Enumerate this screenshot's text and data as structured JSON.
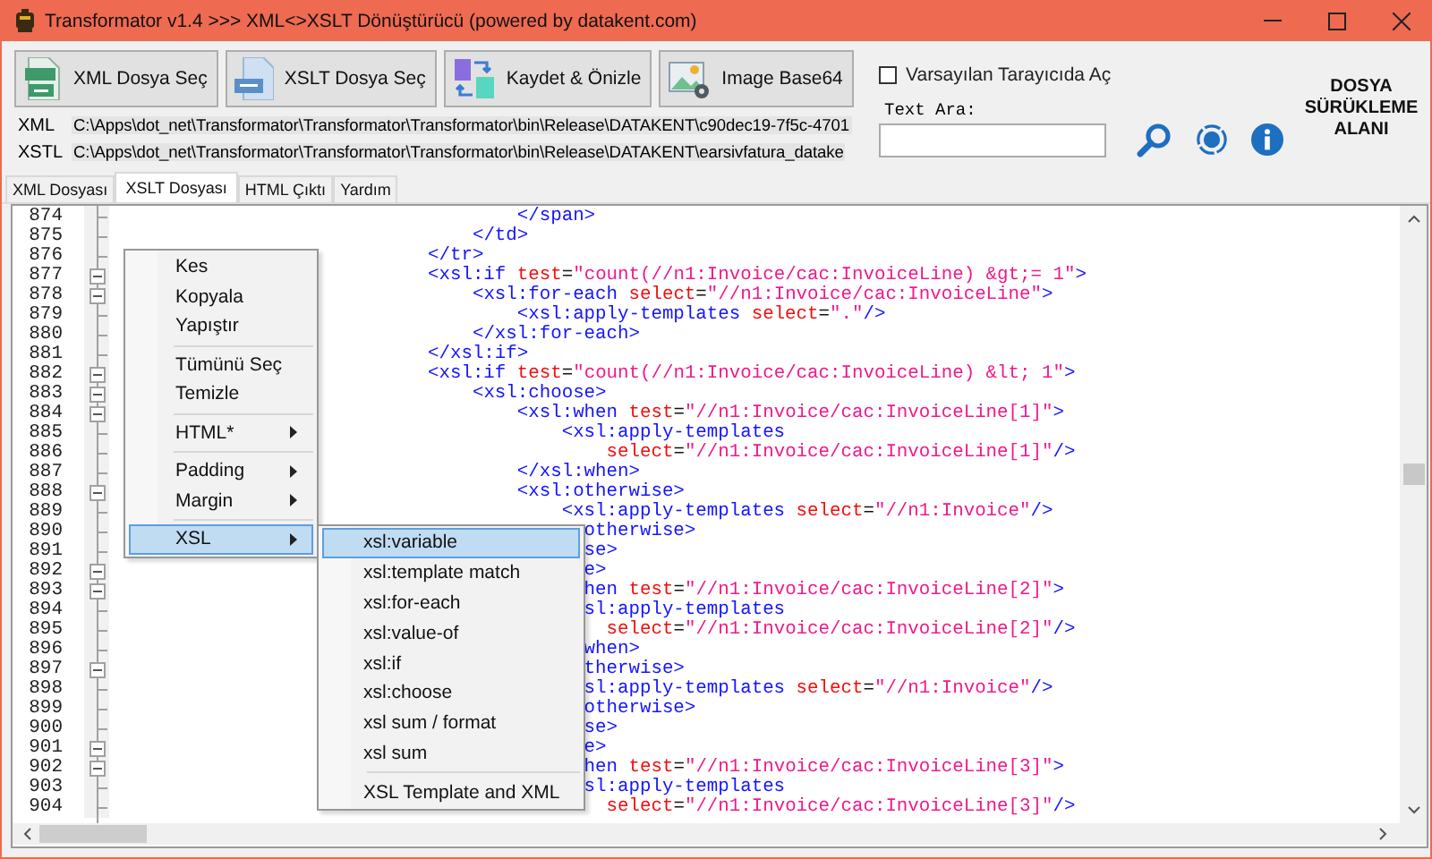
{
  "window": {
    "title": "Transformator v1.4 >>> XML<>XSLT Dönüştürücü (powered by datakent.com)"
  },
  "toolbar": {
    "buttons": [
      {
        "label": "XML Dosya Seç",
        "kind": "xml"
      },
      {
        "label": "XSLT Dosya Seç",
        "kind": "xslt"
      },
      {
        "label": "Kaydet & Önizle",
        "kind": "save"
      },
      {
        "label": "Image Base64",
        "kind": "image"
      }
    ],
    "paths": [
      {
        "label": "XML",
        "value": "C:\\Apps\\dot_net\\Transformator\\Transformator\\Transformator\\bin\\Release\\DATAKENT\\c90dec19-7f5c-4701"
      },
      {
        "label": "XSTL",
        "value": "C:\\Apps\\dot_net\\Transformator\\Transformator\\Transformator\\bin\\Release\\DATAKENT\\earsivfatura_datake"
      }
    ],
    "browser_checkbox": {
      "label": "Varsayılan Tarayıcıda Aç",
      "checked": false
    },
    "search": {
      "label": "Text Ara:"
    },
    "drop_area": {
      "lines": [
        "DOSYA",
        "SÜRÜKLEME",
        "ALANI"
      ]
    }
  },
  "tabs": [
    {
      "label": "XML Dosyası",
      "selected": false
    },
    {
      "label": "XSLT Dosyası",
      "selected": true
    },
    {
      "label": "HTML Çıktı",
      "selected": false
    },
    {
      "label": "Yardım",
      "selected": false
    }
  ],
  "editor": {
    "lines": [
      {
        "number": "874",
        "text": "        </span>",
        "fold": false
      },
      {
        "number": "875",
        "text": "    </td>",
        "fold": false
      },
      {
        "number": "876",
        "text": "</tr>",
        "fold": false
      },
      {
        "number": "877",
        "text": "<xsl:if test=\"count(//n1:Invoice/cac:InvoiceLine) &gt;= 1\">",
        "fold": true
      },
      {
        "number": "878",
        "text": "    <xsl:for-each select=\"//n1:Invoice/cac:InvoiceLine\">",
        "fold": true
      },
      {
        "number": "879",
        "text": "        <xsl:apply-templates select=\".\"/>",
        "fold": false
      },
      {
        "number": "880",
        "text": "    </xsl:for-each>",
        "fold": false
      },
      {
        "number": "881",
        "text": "</xsl:if>",
        "fold": false
      },
      {
        "number": "882",
        "text": "<xsl:if test=\"count(//n1:Invoice/cac:InvoiceLine) &lt; 1\">",
        "fold": true
      },
      {
        "number": "883",
        "text": "    <xsl:choose>",
        "fold": true
      },
      {
        "number": "884",
        "text": "        <xsl:when test=\"//n1:Invoice/cac:InvoiceLine[1]\">",
        "fold": true
      },
      {
        "number": "885",
        "text": "            <xsl:apply-templates",
        "fold": false
      },
      {
        "number": "886",
        "text": "                select=\"//n1:Invoice/cac:InvoiceLine[1]\"/>",
        "fold": false
      },
      {
        "number": "887",
        "text": "        </xsl:when>",
        "fold": false
      },
      {
        "number": "888",
        "text": "        <xsl:otherwise>",
        "fold": true
      },
      {
        "number": "889",
        "text": "            <xsl:apply-templates select=\"//n1:Invoice\"/>",
        "fold": false
      },
      {
        "number": "890",
        "text": "              otherwise>",
        "fold": false
      },
      {
        "number": "891",
        "text": "              se>",
        "fold": false
      },
      {
        "number": "892",
        "text": "              e>",
        "fold": true
      },
      {
        "number": "893",
        "text": "              hen test=\"//n1:Invoice/cac:InvoiceLine[2]\">",
        "fold": true
      },
      {
        "number": "894",
        "text": "              sl:apply-templates",
        "fold": false
      },
      {
        "number": "895",
        "text": "                select=\"//n1:Invoice/cac:InvoiceLine[2]\"/>",
        "fold": false
      },
      {
        "number": "896",
        "text": "              when>",
        "fold": false
      },
      {
        "number": "897",
        "text": "              therwise>",
        "fold": true
      },
      {
        "number": "898",
        "text": "              sl:apply-templates select=\"//n1:Invoice\"/>",
        "fold": false
      },
      {
        "number": "899",
        "text": "              otherwise>",
        "fold": false
      },
      {
        "number": "900",
        "text": "              se>",
        "fold": false
      },
      {
        "number": "901",
        "text": "              e>",
        "fold": true
      },
      {
        "number": "902",
        "text": "              hen test=\"//n1:Invoice/cac:InvoiceLine[3]\">",
        "fold": true
      },
      {
        "number": "903",
        "text": "              sl:apply-templates",
        "fold": false
      },
      {
        "number": "904",
        "text": "                select=\"//n1:Invoice/cac:InvoiceLine[3]\"/>",
        "fold": false
      }
    ]
  },
  "context_menu": {
    "items": [
      {
        "kind": "item",
        "label": "Kes",
        "arrow": false,
        "selected": false
      },
      {
        "kind": "item",
        "label": "Kopyala",
        "arrow": false,
        "selected": false
      },
      {
        "kind": "item",
        "label": "Yapıştır",
        "arrow": false,
        "selected": false
      },
      {
        "kind": "separator"
      },
      {
        "kind": "item",
        "label": "Tümünü Seç",
        "arrow": false,
        "selected": false
      },
      {
        "kind": "item",
        "label": "Temizle",
        "arrow": false,
        "selected": false
      },
      {
        "kind": "separator"
      },
      {
        "kind": "item",
        "label": "HTML*",
        "arrow": true,
        "selected": false
      },
      {
        "kind": "separator"
      },
      {
        "kind": "item",
        "label": "Padding",
        "arrow": true,
        "selected": false
      },
      {
        "kind": "item",
        "label": "Margin",
        "arrow": true,
        "selected": false
      },
      {
        "kind": "separator"
      },
      {
        "kind": "item",
        "label": "XSL",
        "arrow": true,
        "selected": true
      }
    ],
    "submenu": {
      "items": [
        {
          "kind": "item",
          "label": "xsl:variable",
          "selected": true
        },
        {
          "kind": "item",
          "label": "xsl:template match",
          "selected": false
        },
        {
          "kind": "item",
          "label": "xsl:for-each",
          "selected": false
        },
        {
          "kind": "item",
          "label": "xsl:value-of",
          "selected": false
        },
        {
          "kind": "item",
          "label": "xsl:if",
          "selected": false
        },
        {
          "kind": "item",
          "label": "xsl:choose",
          "selected": false
        },
        {
          "kind": "item",
          "label": "xsl sum / format",
          "selected": false
        },
        {
          "kind": "item",
          "label": "xsl sum",
          "selected": false
        },
        {
          "kind": "separator"
        },
        {
          "kind": "item",
          "label": "XSL Template and XML",
          "selected": false
        }
      ]
    }
  }
}
